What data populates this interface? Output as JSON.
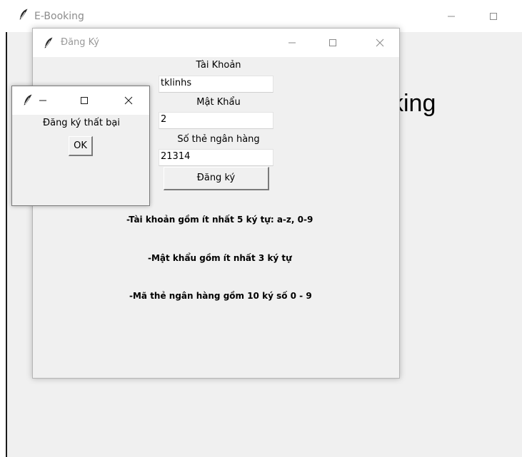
{
  "main_window": {
    "title": "E-Booking",
    "heading_visible": "king",
    "icon": "feather-icon"
  },
  "register_window": {
    "title": "Đăng Ký",
    "icon": "feather-icon",
    "username_label": "Tài Khoản",
    "username_value": "tklinhs",
    "password_label": "Mật Khẩu",
    "password_value": "2",
    "card_label": "Số thẻ ngân hàng",
    "card_value": "21314",
    "submit_label": "Đăng ký",
    "rules": [
      "-Tài khoản gồm ít nhất 5 ký tự: a-z, 0-9",
      "-Mật khẩu gồm ít nhất 3 ký tự",
      "-Mã thẻ ngân hàng gồm 10 ký số 0 - 9"
    ]
  },
  "dialog": {
    "message": "Đăng ký thất bại",
    "ok_label": "OK",
    "icon": "feather-icon"
  },
  "colors": {
    "window_bg": "#f0f0f0",
    "titlebar_bg": "#ffffff",
    "title_text": "#999999"
  }
}
